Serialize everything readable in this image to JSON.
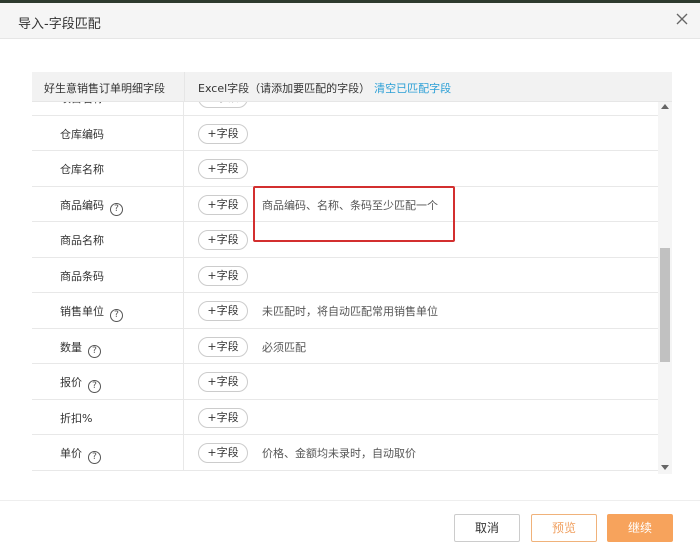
{
  "dialog": {
    "title": "导入-字段匹配"
  },
  "table": {
    "header": {
      "col1": "好生意销售订单明细字段",
      "col2": "Excel字段（请添加要匹配的字段）",
      "clear_link": "清空已匹配字段"
    },
    "add_button_label": "+字段",
    "rows": [
      {
        "name": "项目名称",
        "has_help": false,
        "note": ""
      },
      {
        "name": "仓库编码",
        "has_help": false,
        "note": ""
      },
      {
        "name": "仓库名称",
        "has_help": false,
        "note": ""
      },
      {
        "name": "商品编码",
        "has_help": true,
        "note": "商品编码、名称、条码至少匹配一个"
      },
      {
        "name": "商品名称",
        "has_help": false,
        "note": ""
      },
      {
        "name": "商品条码",
        "has_help": false,
        "note": ""
      },
      {
        "name": "销售单位",
        "has_help": true,
        "note": "未匹配时，将自动匹配常用销售单位"
      },
      {
        "name": "数量",
        "has_help": true,
        "note": "必须匹配"
      },
      {
        "name": "报价",
        "has_help": true,
        "note": ""
      },
      {
        "name": "折扣%",
        "has_help": false,
        "note": ""
      },
      {
        "name": "单价",
        "has_help": true,
        "note": "价格、金额均未录时，自动取价"
      }
    ]
  },
  "footer": {
    "cancel": "取消",
    "preview": "预览",
    "continue": "继续"
  },
  "colors": {
    "accent_orange": "#f7a35c",
    "link_blue": "#2a9fd6",
    "highlight_red": "#d32f2f"
  },
  "icons": {
    "close": "close-icon",
    "help": "question-circle-icon"
  }
}
